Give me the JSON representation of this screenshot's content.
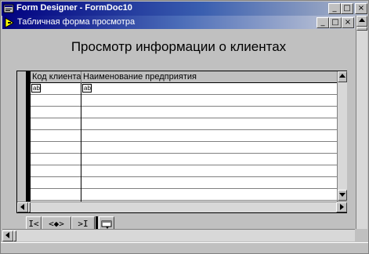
{
  "outer_window": {
    "title": "Form Designer - FormDoc10",
    "buttons": {
      "minimize": "_",
      "maximize": "□",
      "close": "×"
    }
  },
  "inner_window": {
    "title": "Табличная форма просмотра",
    "buttons": {
      "minimize": "_",
      "maximize": "□",
      "close": "×"
    }
  },
  "form": {
    "heading": "Просмотр информации о клиентах"
  },
  "grid": {
    "columns": [
      {
        "label": "Код клиента"
      },
      {
        "label": "Наименование предприятия"
      }
    ],
    "first_row_cells": [
      "abl",
      "abl"
    ]
  },
  "navigator": {
    "first": "I<",
    "prev_next": "<◆>",
    "last": ">I"
  },
  "colors": {
    "title_active": "#000080",
    "face": "#c0c0c0",
    "grid_bg": "#ffffff"
  }
}
